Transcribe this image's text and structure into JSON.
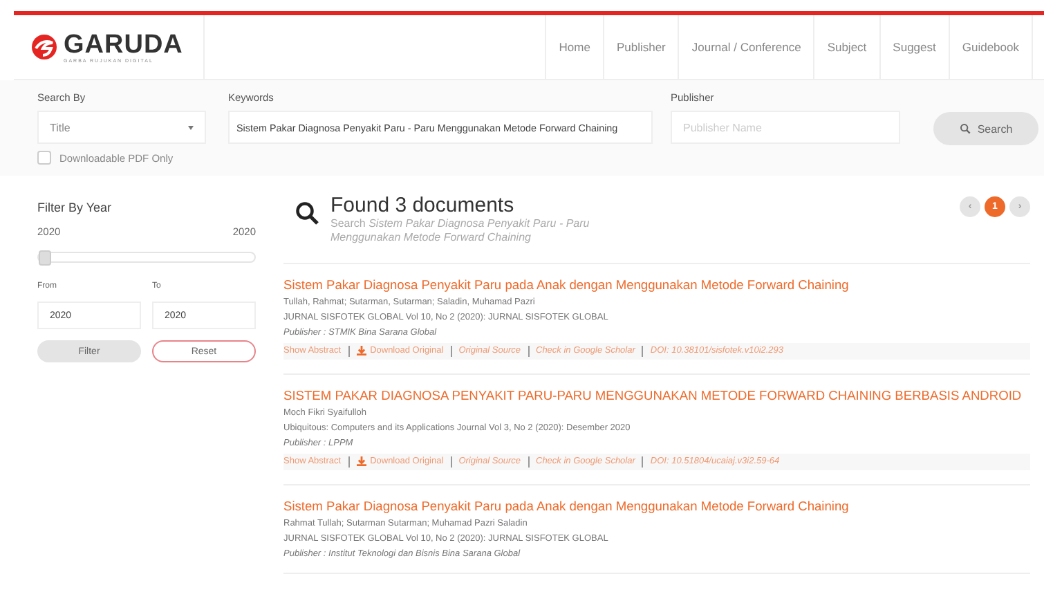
{
  "brand": {
    "name": "GARUDA",
    "tagline": "GARBA RUJUKAN DIGITAL"
  },
  "nav": [
    {
      "label": "Home"
    },
    {
      "label": "Publisher"
    },
    {
      "label": "Journal / Conference"
    },
    {
      "label": "Subject"
    },
    {
      "label": "Suggest"
    },
    {
      "label": "Guidebook"
    }
  ],
  "search": {
    "search_by_label": "Search By",
    "search_by_value": "Title",
    "keywords_label": "Keywords",
    "keywords_value": "Sistem Pakar Diagnosa Penyakit Paru - Paru Menggunakan Metode Forward Chaining",
    "publisher_label": "Publisher",
    "publisher_placeholder": "Publisher Name",
    "button": "Search",
    "pdf_only": {
      "label": "Downloadable PDF Only",
      "checked": false
    }
  },
  "filter": {
    "title": "Filter By Year",
    "min": "2020",
    "max": "2020",
    "level": 0,
    "from_label": "From",
    "to_label": "To",
    "from_value": "2020",
    "to_value": "2020",
    "filter_button": "Filter",
    "reset_button": "Reset"
  },
  "results": {
    "heading": "Found 3 documents",
    "query_label": "Search",
    "query": "Sistem Pakar Diagnosa Penyakit Paru - Paru Menggunakan Metode Forward Chaining"
  },
  "pagination": {
    "prev": "‹",
    "next": "›",
    "pages": [
      {
        "label": "1",
        "selected": true
      }
    ]
  },
  "documents": [
    {
      "title": "Sistem Pakar Diagnosa Penyakit Paru pada Anak dengan Menggunakan Metode Forward Chaining",
      "authors": "Tullah, Rahmat; Sutarman, Sutarman; Saladin, Muhamad Pazri",
      "source": "JURNAL SISFOTEK GLOBAL Vol 10, No 2 (2020): JURNAL SISFOTEK GLOBAL",
      "publisher": "Publisher : STMIK Bina Sarana Global",
      "links": [
        "Show Abstract",
        "Download Original",
        "Original Source",
        "Check in Google Scholar",
        "DOI: 10.38101/sisfotek.v10i2.293"
      ]
    },
    {
      "title": "SISTEM PAKAR DIAGNOSA PENYAKIT PARU-PARU MENGGUNAKAN METODE FORWARD CHAINING BERBASIS ANDROID",
      "authors": "Moch Fikri Syaifulloh",
      "source": "Ubiquitous: Computers and its Applications Journal Vol 3, No 2 (2020): Desember 2020",
      "publisher": "Publisher : LPPM",
      "links": [
        "Show Abstract",
        "Download Original",
        "Original Source",
        "Check in Google Scholar",
        "DOI: 10.51804/ucaiaj.v3i2.59-64"
      ]
    },
    {
      "title": "Sistem Pakar Diagnosa Penyakit Paru pada Anak dengan Menggunakan Metode Forward Chaining",
      "authors": "Rahmat Tullah; Sutarman Sutarman; Muhamad Pazri Saladin",
      "source": "JURNAL SISFOTEK GLOBAL Vol 10, No 2 (2020): JURNAL SISFOTEK GLOBAL",
      "publisher": "Publisher : Institut Teknologi dan Bisnis Bina Sarana Global"
    }
  ]
}
